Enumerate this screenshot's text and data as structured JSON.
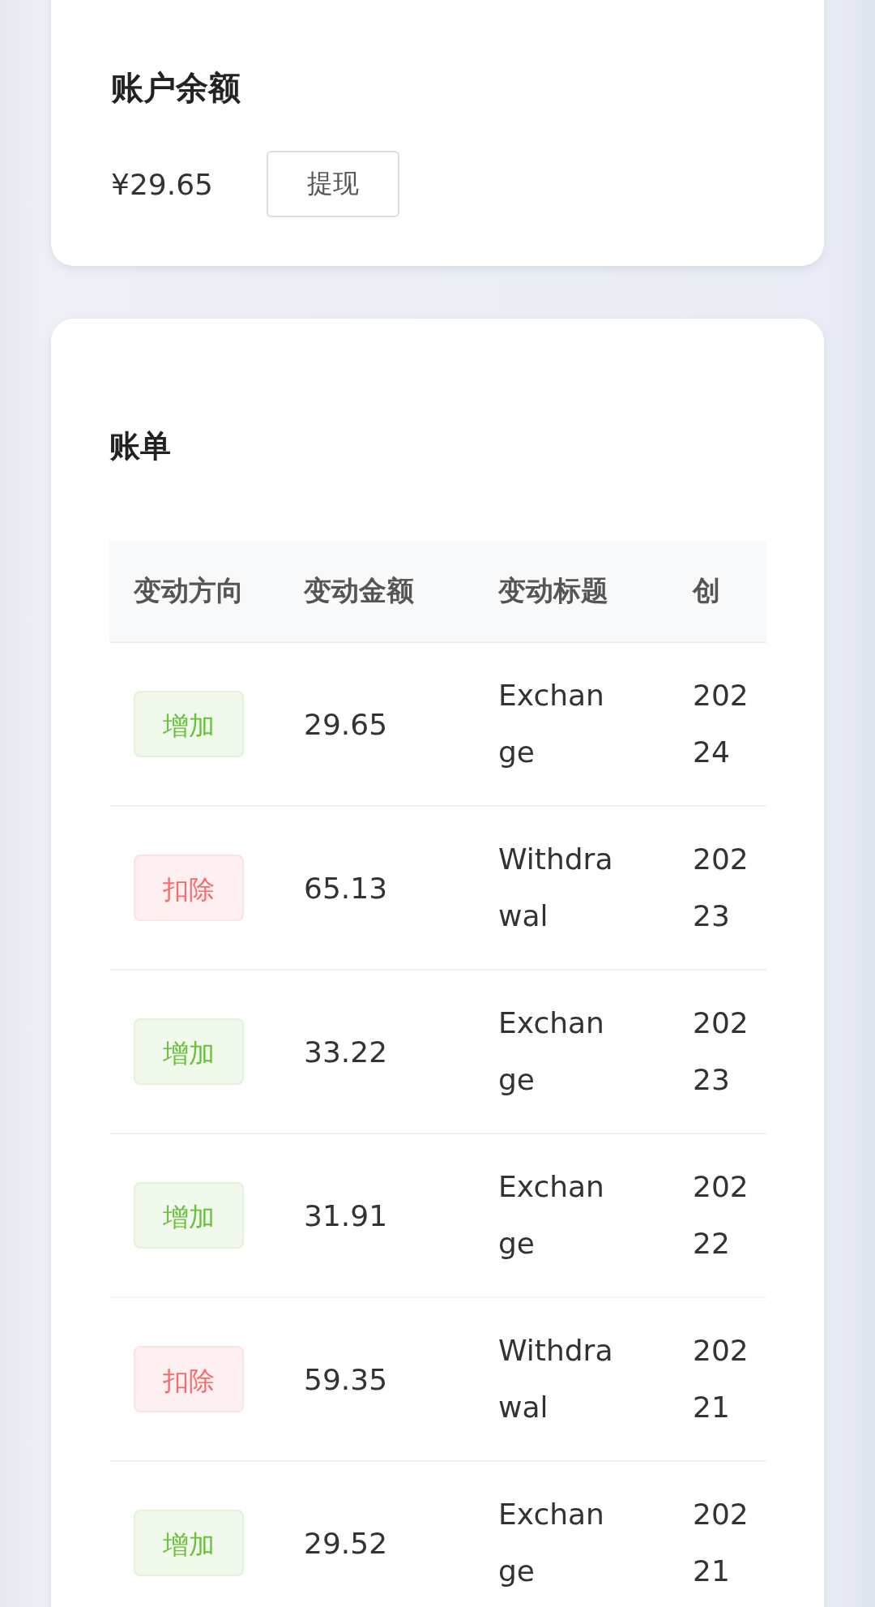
{
  "balance": {
    "title": "账户余额",
    "amount": "¥29.65",
    "withdraw_button": "提现"
  },
  "bill": {
    "title": "账单",
    "columns": [
      "变动方向",
      "变动金额",
      "变动标题",
      "创"
    ],
    "rows": [
      {
        "direction": "增加",
        "kind": "increase",
        "amount": "29.65",
        "title": "Exchange",
        "created_lines": [
          "202",
          "24"
        ]
      },
      {
        "direction": "扣除",
        "kind": "deduct",
        "amount": "65.13",
        "title": "Withdrawal",
        "created_lines": [
          "202",
          "23"
        ]
      },
      {
        "direction": "增加",
        "kind": "increase",
        "amount": "33.22",
        "title": "Exchange",
        "created_lines": [
          "202",
          "23"
        ]
      },
      {
        "direction": "增加",
        "kind": "increase",
        "amount": "31.91",
        "title": "Exchange",
        "created_lines": [
          "202",
          "22"
        ]
      },
      {
        "direction": "扣除",
        "kind": "deduct",
        "amount": "59.35",
        "title": "Withdrawal",
        "created_lines": [
          "202",
          "21"
        ]
      },
      {
        "direction": "增加",
        "kind": "increase",
        "amount": "29.52",
        "title": "Exchange",
        "created_lines": [
          "202",
          "21"
        ]
      }
    ]
  }
}
